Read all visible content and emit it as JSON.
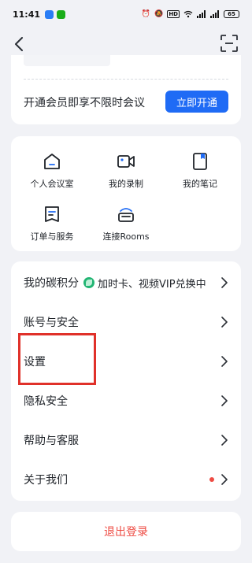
{
  "status_bar": {
    "time": "11:41",
    "app_icons": [
      {
        "name": "alipay-icon",
        "color": "#2a7df5"
      },
      {
        "name": "wechat-icon",
        "color": "#1aad19"
      }
    ],
    "network_label": "HD",
    "battery": "65"
  },
  "nav": {
    "back_icon": "chevron-left-icon",
    "scan_icon": "scan-icon"
  },
  "member": {
    "text": "开通会员即享不限时会议",
    "button": "立即开通"
  },
  "grid": {
    "items": [
      {
        "label": "个人会议室",
        "icon": "house-icon"
      },
      {
        "label": "我的录制",
        "icon": "video-camera-icon"
      },
      {
        "label": "我的笔记",
        "icon": "note-icon"
      },
      {
        "label": "订单与服务",
        "icon": "order-icon"
      },
      {
        "label": "连接Rooms",
        "icon": "cast-icon"
      }
    ]
  },
  "menu": {
    "carbon_label": "我的碳积分",
    "carbon_extra": "加时卡、视频VIP兑换中",
    "account": "账号与安全",
    "settings": "设置",
    "privacy": "隐私安全",
    "help": "帮助与客服",
    "about": "关于我们"
  },
  "logout": {
    "label": "退出登录"
  },
  "colors": {
    "accent": "#1f6bf5",
    "danger": "#ee4b43",
    "highlight": "#e0312a",
    "background": "#f1f2f6"
  }
}
